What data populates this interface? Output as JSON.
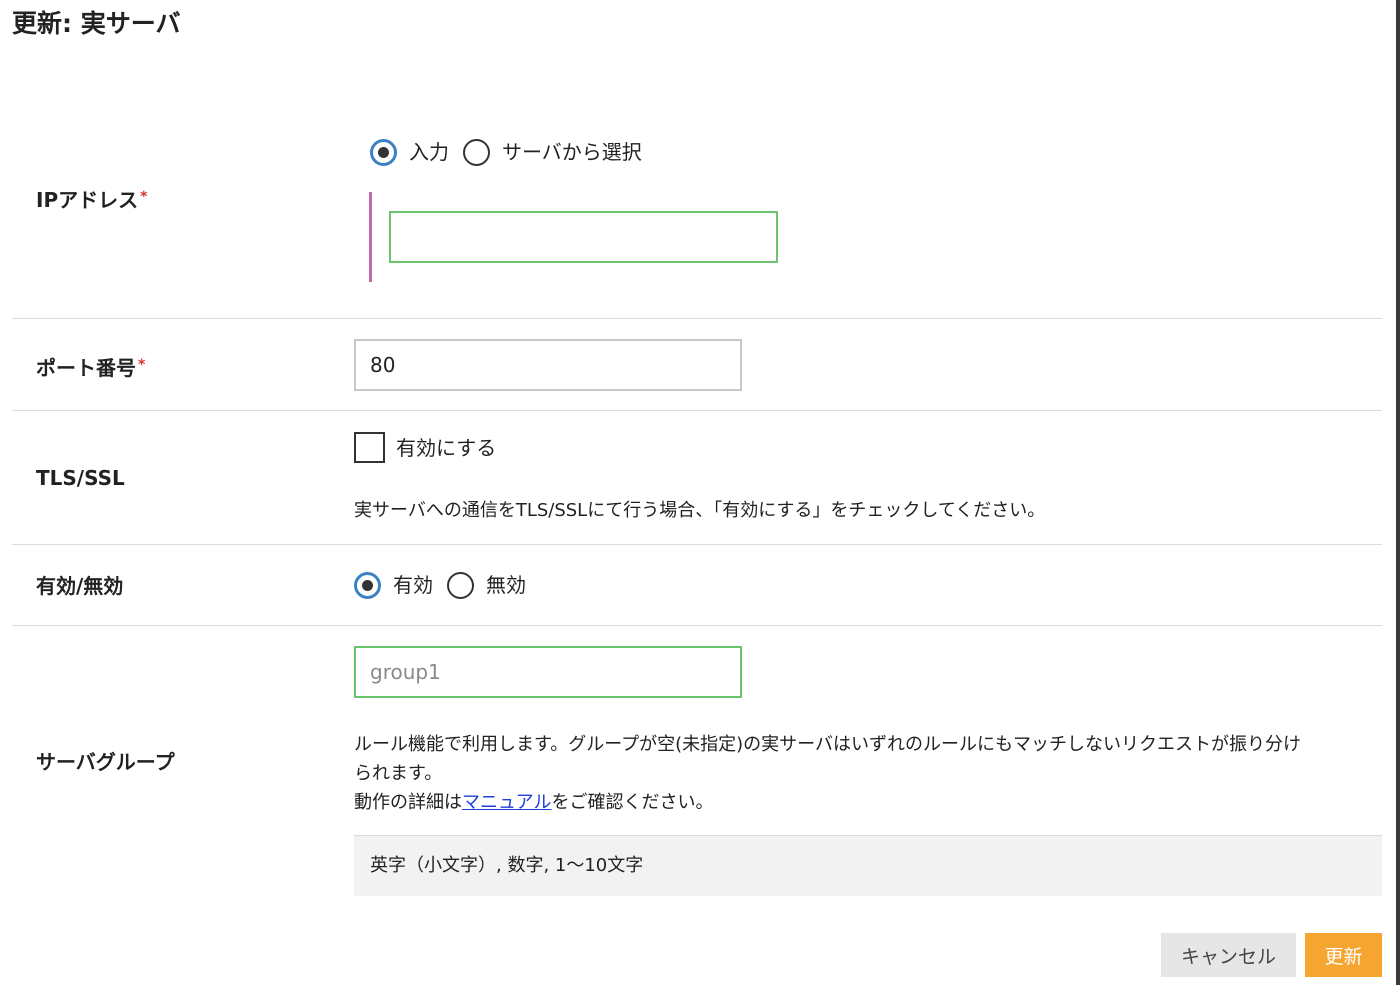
{
  "dialog": {
    "title": "更新: 実サーバ"
  },
  "fields": {
    "ip_address": {
      "label": "IPアドレス",
      "required_mark": "*",
      "mode_options": [
        {
          "label": "入力",
          "selected": true
        },
        {
          "label": "サーバから選択",
          "selected": false
        }
      ],
      "value": ""
    },
    "port": {
      "label": "ポート番号",
      "required_mark": "*",
      "value": "80"
    },
    "tls_ssl": {
      "label": "TLS/SSL",
      "checkbox_label": "有効にする",
      "checked": false,
      "help": "実サーバへの通信をTLS/SSLにて行う場合、「有効にする」をチェックしてください。"
    },
    "enabled": {
      "label": "有効/無効",
      "options": [
        {
          "label": "有効",
          "selected": true
        },
        {
          "label": "無効",
          "selected": false
        }
      ]
    },
    "server_group": {
      "label": "サーバグループ",
      "placeholder": "group1",
      "value": "",
      "help_line1": "ルール機能で利用します。グループが空(未指定)の実サーバはいずれのルールにもマッチしないリクエストが振り分け",
      "help_line2": "られます。",
      "help_line3_prefix": "動作の詳細は",
      "help_link": "マニュアル",
      "help_line3_suffix": "をご確認ください。",
      "hint": "英字（小文字）, 数字, 1〜10文字"
    }
  },
  "buttons": {
    "cancel": "キャンセル",
    "submit": "更新"
  },
  "colors": {
    "accent_bar": "#c06aa8",
    "radio_selected": "#3b82c4",
    "valid_border": "#6cc56c",
    "submit_button": "#f5a530",
    "required": "#d9322e",
    "link": "#1f3fd6"
  }
}
